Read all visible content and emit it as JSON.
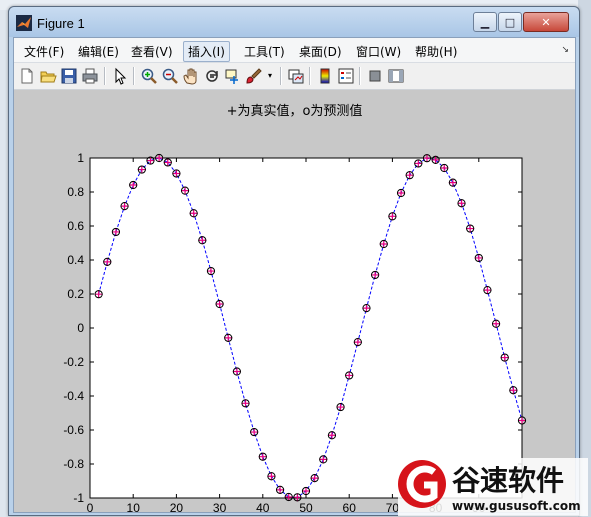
{
  "window": {
    "title": "Figure 1"
  },
  "window_buttons": {
    "minimize": "▁",
    "maximize": "□",
    "close": "✕"
  },
  "menu": {
    "items": [
      "文件(F)",
      "编辑(E)",
      "查看(V)",
      "插入(I)",
      "工具(T)",
      "桌面(D)",
      "窗口(W)",
      "帮助(H)"
    ],
    "highlighted": "插入(I)"
  },
  "toolbar": {
    "icons": [
      "new-file-icon",
      "open-folder-icon",
      "save-icon",
      "print-icon",
      "pointer-icon",
      "zoom-in-icon",
      "zoom-out-icon",
      "pan-hand-icon",
      "rotate-3d-icon",
      "data-cursor-icon",
      "brush-icon",
      "brush-dropdown-icon",
      "link-plot-icon",
      "colorbar-icon",
      "legend-icon",
      "hide-plot-tools-icon",
      "show-plot-tools-icon"
    ]
  },
  "chart_data": {
    "type": "line",
    "title": "+为真实值，o为预测值",
    "xlabel": "",
    "ylabel": "",
    "xlim": [
      0,
      100
    ],
    "ylim": [
      -1,
      1
    ],
    "x_ticks": [
      "0",
      "10",
      "20",
      "30",
      "40",
      "50",
      "60",
      "70",
      "80",
      "90"
    ],
    "y_ticks": [
      "1",
      "0.8",
      "0.6",
      "0.4",
      "0.2",
      "0",
      "-0.2",
      "-0.4",
      "-0.6",
      "-0.8",
      "-1"
    ],
    "grid": false,
    "x_step": 0.1,
    "x": [
      0.2,
      0.4,
      0.6,
      0.8,
      1.0,
      1.2,
      1.4,
      1.6,
      1.8,
      2.0,
      2.2,
      2.4,
      2.6,
      2.8,
      3.0,
      3.2,
      3.4,
      3.6,
      3.8,
      4.0,
      4.2,
      4.4,
      4.6,
      4.8,
      5.0,
      5.2,
      5.4,
      5.6,
      5.8,
      6.0,
      6.2,
      6.4,
      6.6,
      6.8,
      7.0,
      7.2,
      7.4,
      7.6,
      7.8,
      8.0,
      8.2,
      8.4,
      8.6,
      8.8,
      9.0,
      9.2,
      9.4,
      9.6,
      9.8,
      10.0
    ],
    "series": [
      {
        "name": "真实值",
        "marker": "+",
        "color": "#e6007e",
        "values": [
          0.199,
          0.389,
          0.565,
          0.717,
          0.841,
          0.932,
          0.985,
          1.0,
          0.974,
          0.909,
          0.808,
          0.675,
          0.516,
          0.335,
          0.141,
          -0.058,
          -0.256,
          -0.443,
          -0.612,
          -0.757,
          -0.872,
          -0.952,
          -0.994,
          -0.996,
          -0.959,
          -0.883,
          -0.773,
          -0.631,
          -0.465,
          -0.279,
          -0.083,
          0.117,
          0.312,
          0.494,
          0.657,
          0.794,
          0.899,
          0.968,
          0.999,
          0.989,
          0.941,
          0.855,
          0.734,
          0.585,
          0.412,
          0.223,
          0.025,
          -0.174,
          -0.366,
          -0.544
        ]
      },
      {
        "name": "预测值",
        "marker": "o",
        "color": "#000000",
        "line": "dashed",
        "line_color": "#0000ff",
        "values": [
          0.199,
          0.389,
          0.565,
          0.717,
          0.841,
          0.932,
          0.985,
          1.0,
          0.974,
          0.909,
          0.808,
          0.675,
          0.516,
          0.335,
          0.141,
          -0.058,
          -0.256,
          -0.443,
          -0.612,
          -0.757,
          -0.872,
          -0.952,
          -0.994,
          -0.996,
          -0.959,
          -0.883,
          -0.773,
          -0.631,
          -0.465,
          -0.279,
          -0.083,
          0.117,
          0.312,
          0.494,
          0.657,
          0.794,
          0.899,
          0.968,
          0.999,
          0.989,
          0.941,
          0.855,
          0.734,
          0.585,
          0.412,
          0.223,
          0.025,
          -0.174,
          -0.366,
          -0.544
        ]
      }
    ]
  },
  "watermark": {
    "brand": "谷速软件",
    "url": "www.gususoft.com"
  }
}
